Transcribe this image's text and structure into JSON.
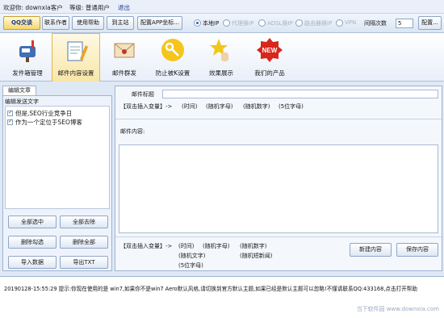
{
  "topbar": {
    "welcome": "欢迎你: downxia客户",
    "level": "等级: 普通用户",
    "logout": "退出"
  },
  "toolbar": {
    "qq": "QQ交谈",
    "contact_author": "联系作者",
    "help": "使用帮助",
    "main_site": "到主站",
    "config_app": "配置APP坐标...",
    "mode_local": "本地IP",
    "mode_proxy": "代理换IP",
    "mode_adsl": "ADSL换IP",
    "mode_router": "路由器换IP",
    "mode_vpn": "VPN",
    "interval_label": "间隔次数",
    "interval_value": "5",
    "config": "配置..."
  },
  "nav": [
    {
      "label": "发件箱管理",
      "icon": "mailbox-icon"
    },
    {
      "label": "邮件内容设置",
      "icon": "edit-document-icon"
    },
    {
      "label": "邮件群发",
      "icon": "envelope-icon"
    },
    {
      "label": "防止被K设置",
      "icon": "key-icon"
    },
    {
      "label": "效果展示",
      "icon": "star-hand-icon"
    },
    {
      "label": "我们的产品",
      "icon": "new-badge-icon"
    }
  ],
  "left": {
    "tab": "编辑文章",
    "section": "编辑发送文字",
    "items": [
      "但是,SEO行业竞争日",
      "作为一个定位于SEO博客"
    ],
    "select_all": "全部选中",
    "remove_all": "全部去除",
    "delete_checked": "删除勾选",
    "delete_all": "删除全部",
    "import": "导入数据",
    "export": "导出TXT"
  },
  "right": {
    "title_label": "邮件标题",
    "insert_var": "【双击插入变量】->",
    "vars_top": [
      "(时间)",
      "(随机字母)",
      "(随机数字)",
      "(5位字母)"
    ],
    "content_label": "邮件内容:",
    "insert_var2": "【双击插入变量】->",
    "vars_bottom": [
      "(时间)",
      "(随机字母)",
      "(随机数字)",
      "(随机文字)",
      "(随机短新闻)",
      "(5位字母)"
    ],
    "new_content": "新建内容",
    "save_content": "保存内容"
  },
  "status": {
    "log": "20190128-15:55:29  提示:你现在使用的是 win7,如果你不是win7 Aero默认风格,请切换到官方默认主题,如果已经是默认主题可以忽略!不懂请联系QQ:433168,点击打开帮助",
    "watermark": "当下软件园 www.downxia.com"
  }
}
